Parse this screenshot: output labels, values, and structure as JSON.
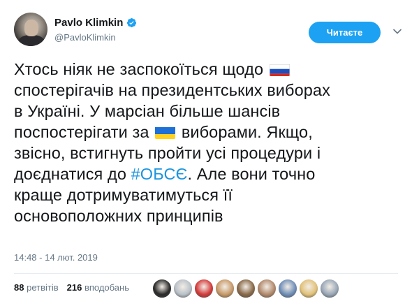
{
  "author": {
    "display_name": "Pavlo Klimkin",
    "handle": "@PavloKlimkin",
    "verified": true
  },
  "follow_button": {
    "label": "Читаєте"
  },
  "tweet": {
    "lines": [
      "Хтось ніяк не заспокоїться щодо",
      "спостерігачів на президентських виборах",
      "в Україні. У марсіан більше шансів",
      "поспостерігати за",
      "виборами. Якщо,",
      "звісно, встигнуть пройти усі процедури і",
      "доєднатися до",
      "#ОБСЄ",
      ". Але вони точно",
      "краще дотримуватимуться її",
      "основоположних принципів"
    ],
    "emoji": [
      "russian-flag-emoji",
      "ukrainian-flag-emoji"
    ]
  },
  "timestamp": "14:48 - 14 лют. 2019",
  "stats": {
    "retweets_count": "88",
    "retweets_label": "ретвітів",
    "likes_count": "216",
    "likes_label": "вподобань"
  },
  "likers": [
    {
      "color": "#2b2b2b"
    },
    {
      "color": "#b9c1c8"
    },
    {
      "color": "#d43c3c"
    },
    {
      "color": "#c89a6a"
    },
    {
      "color": "#8a6a4a"
    },
    {
      "color": "#b28a6c"
    },
    {
      "color": "#6f8fb8"
    },
    {
      "color": "#e2c27a"
    },
    {
      "color": "#9aa8b8"
    }
  ],
  "colors": {
    "accent": "#1da1f2",
    "hashtag": "#1b95e0",
    "muted": "#657786"
  }
}
